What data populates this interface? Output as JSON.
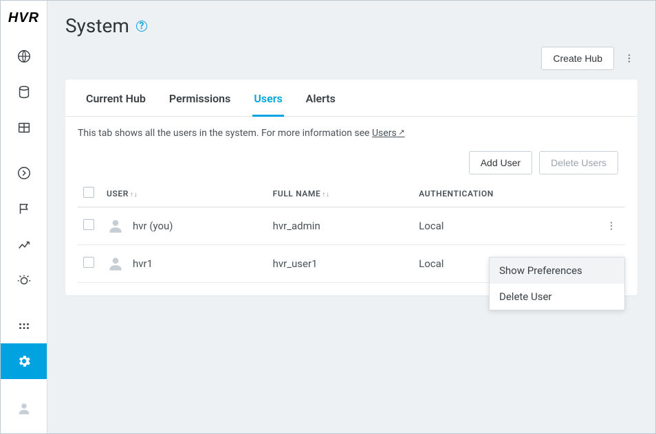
{
  "brand": "HVR",
  "page": {
    "title": "System"
  },
  "topActions": {
    "createHub": "Create Hub"
  },
  "tabs": [
    {
      "label": "Current Hub",
      "active": false
    },
    {
      "label": "Permissions",
      "active": false
    },
    {
      "label": "Users",
      "active": true
    },
    {
      "label": "Alerts",
      "active": false
    }
  ],
  "description": {
    "pre": "This tab shows all the users in the system. For more information see ",
    "linkText": "Users"
  },
  "tableActions": {
    "addUser": "Add User",
    "deleteUsers": "Delete Users"
  },
  "columns": {
    "user": "USER",
    "fullName": "FULL NAME",
    "auth": "AUTHENTICATION"
  },
  "rows": [
    {
      "user": "hvr (you)",
      "fullName": "hvr_admin",
      "auth": "Local"
    },
    {
      "user": "hvr1",
      "fullName": "hvr_user1",
      "auth": "Local"
    }
  ],
  "contextMenu": {
    "items": [
      {
        "label": "Show Preferences",
        "hover": true
      },
      {
        "label": "Delete User",
        "hover": false
      }
    ]
  }
}
